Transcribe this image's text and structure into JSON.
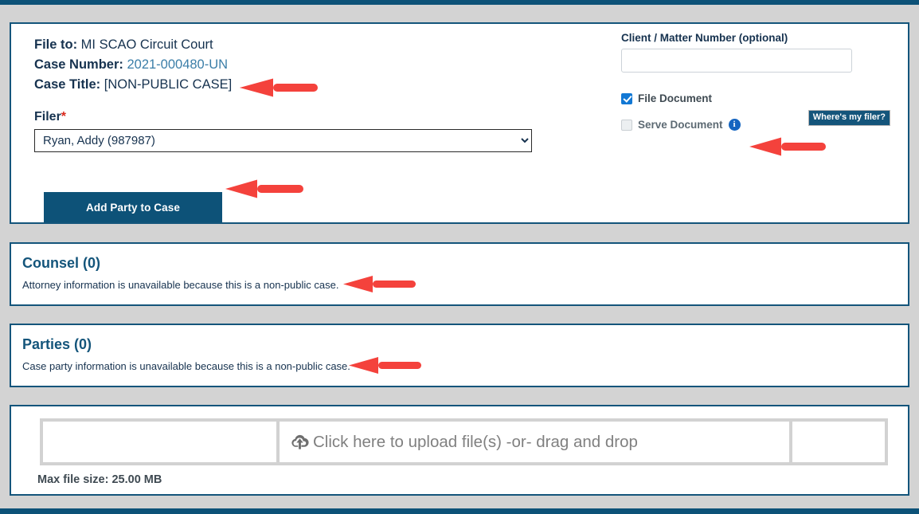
{
  "theme": {
    "accent": "#0d5278",
    "card_border": "#14557b",
    "page_bg": "#d3d3d3",
    "arrow_red": "#f4423c",
    "link_blue": "#3b7ea8",
    "checkbox_blue": "#1278d4"
  },
  "case_info": {
    "file_to_label": "File to:",
    "file_to_value": "MI SCAO Circuit Court",
    "case_number_label": "Case Number:",
    "case_number_value": "2021-000480-UN",
    "case_title_label": "Case Title:",
    "case_title_value": "[NON-PUBLIC CASE]",
    "filer_label": "Filer",
    "filer_required_marker": "*",
    "filer_selected": "Ryan, Addy (987987)",
    "filer_options": [
      "Ryan, Addy (987987)"
    ],
    "wheres_my_filer": "Where's my filer?",
    "add_party_button": "Add Party to Case"
  },
  "filing_options": {
    "client_matter_label": "Client / Matter Number (optional)",
    "client_matter_value": "",
    "client_matter_placeholder": "",
    "file_document_label": "File Document",
    "file_document_checked": true,
    "serve_document_label": "Serve Document",
    "serve_document_checked": false,
    "serve_document_disabled": true,
    "serve_info_icon": "info-icon"
  },
  "counsel": {
    "title": "Counsel (0)",
    "note": "Attorney information is unavailable because this is a non-public case."
  },
  "parties": {
    "title": "Parties (0)",
    "note": "Case party information is unavailable because this is a non-public case."
  },
  "upload": {
    "drop_text": "Click here to upload file(s) -or- drag and drop",
    "icon": "cloud-upload-icon",
    "max_file_size": "Max file size: 25.00 MB"
  },
  "annotations": {
    "arrow_case_title": "arrow-pointing-case-title",
    "arrow_serve_document": "arrow-pointing-serve-document",
    "arrow_add_party": "arrow-pointing-add-party-button",
    "arrow_counsel_note": "arrow-pointing-counsel-note",
    "arrow_parties_note": "arrow-pointing-parties-note"
  }
}
